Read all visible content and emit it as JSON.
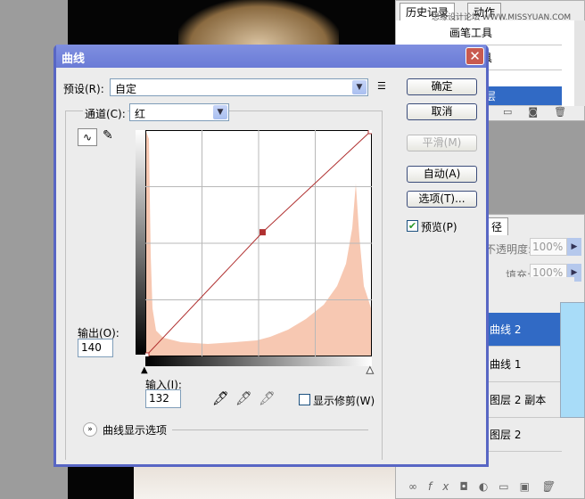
{
  "background_panels": {
    "history_tabs": [
      "历史记录",
      "动作"
    ],
    "watermark": "思缘设计论坛 WWW.MISSYUAN.COM",
    "history_items": [
      "画笔工具",
      "画笔工具",
      "",
      "层"
    ],
    "layers_tab": "径",
    "opacity_label": "不透明度:",
    "opacity_value": "100%",
    "fill_label": "填充:",
    "fill_value": "100%",
    "layers": [
      "曲线 2",
      "曲线 1",
      "图层 2 副本",
      "图层 2"
    ],
    "selected_layer": "曲线 2"
  },
  "dialog": {
    "title": "曲线",
    "preset_label": "预设(R):",
    "preset_value": "自定",
    "channel_label": "通道(C):",
    "channel_value": "红",
    "buttons": {
      "ok": "确定",
      "cancel": "取消",
      "smooth": "平滑(M)",
      "auto": "自动(A)",
      "options": "选项(T)..."
    },
    "preview_label": "预览(P)",
    "preview_checked": true,
    "output_label": "输出(O):",
    "output_value": "140",
    "input_label": "输入(I):",
    "input_value": "132",
    "show_clipping_label": "显示修剪(W)",
    "show_clipping_checked": false,
    "curve_display_options": "曲线显示选项",
    "curve_points": [
      [
        0,
        0
      ],
      [
        132,
        140
      ],
      [
        255,
        255
      ]
    ],
    "colors": {
      "histogram": "#f7c8b2",
      "curve": "#b03030",
      "title_bar": "#6a7bd6",
      "selected_layer": "#316ac5"
    }
  }
}
